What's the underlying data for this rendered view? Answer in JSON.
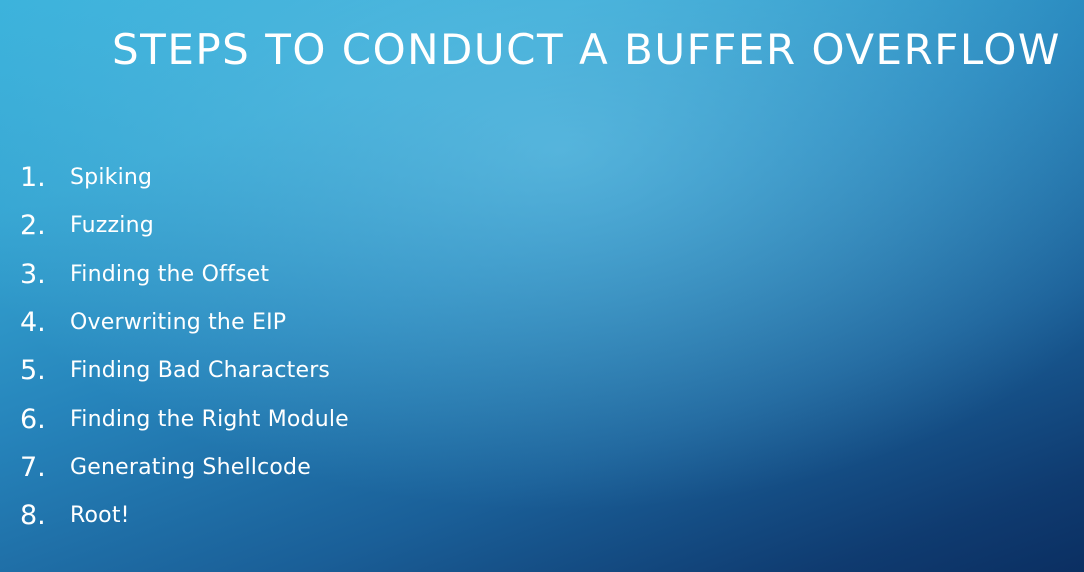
{
  "slide": {
    "title": "STEPS TO CONDUCT A BUFFER OVERFLOW",
    "steps": [
      {
        "number": "1.",
        "label": "Spiking"
      },
      {
        "number": "2.",
        "label": "Fuzzing"
      },
      {
        "number": "3.",
        "label": "Finding the Offset"
      },
      {
        "number": "4.",
        "label": "Overwriting the EIP"
      },
      {
        "number": "5.",
        "label": "Finding Bad Characters"
      },
      {
        "number": "6.",
        "label": "Finding the Right Module"
      },
      {
        "number": "7.",
        "label": "Generating Shellcode"
      },
      {
        "number": "8.",
        "label": "Root!"
      }
    ]
  },
  "colors": {
    "background_top": "#3cb3dc",
    "background_bottom": "#0b2f62",
    "text": "#ffffff"
  }
}
